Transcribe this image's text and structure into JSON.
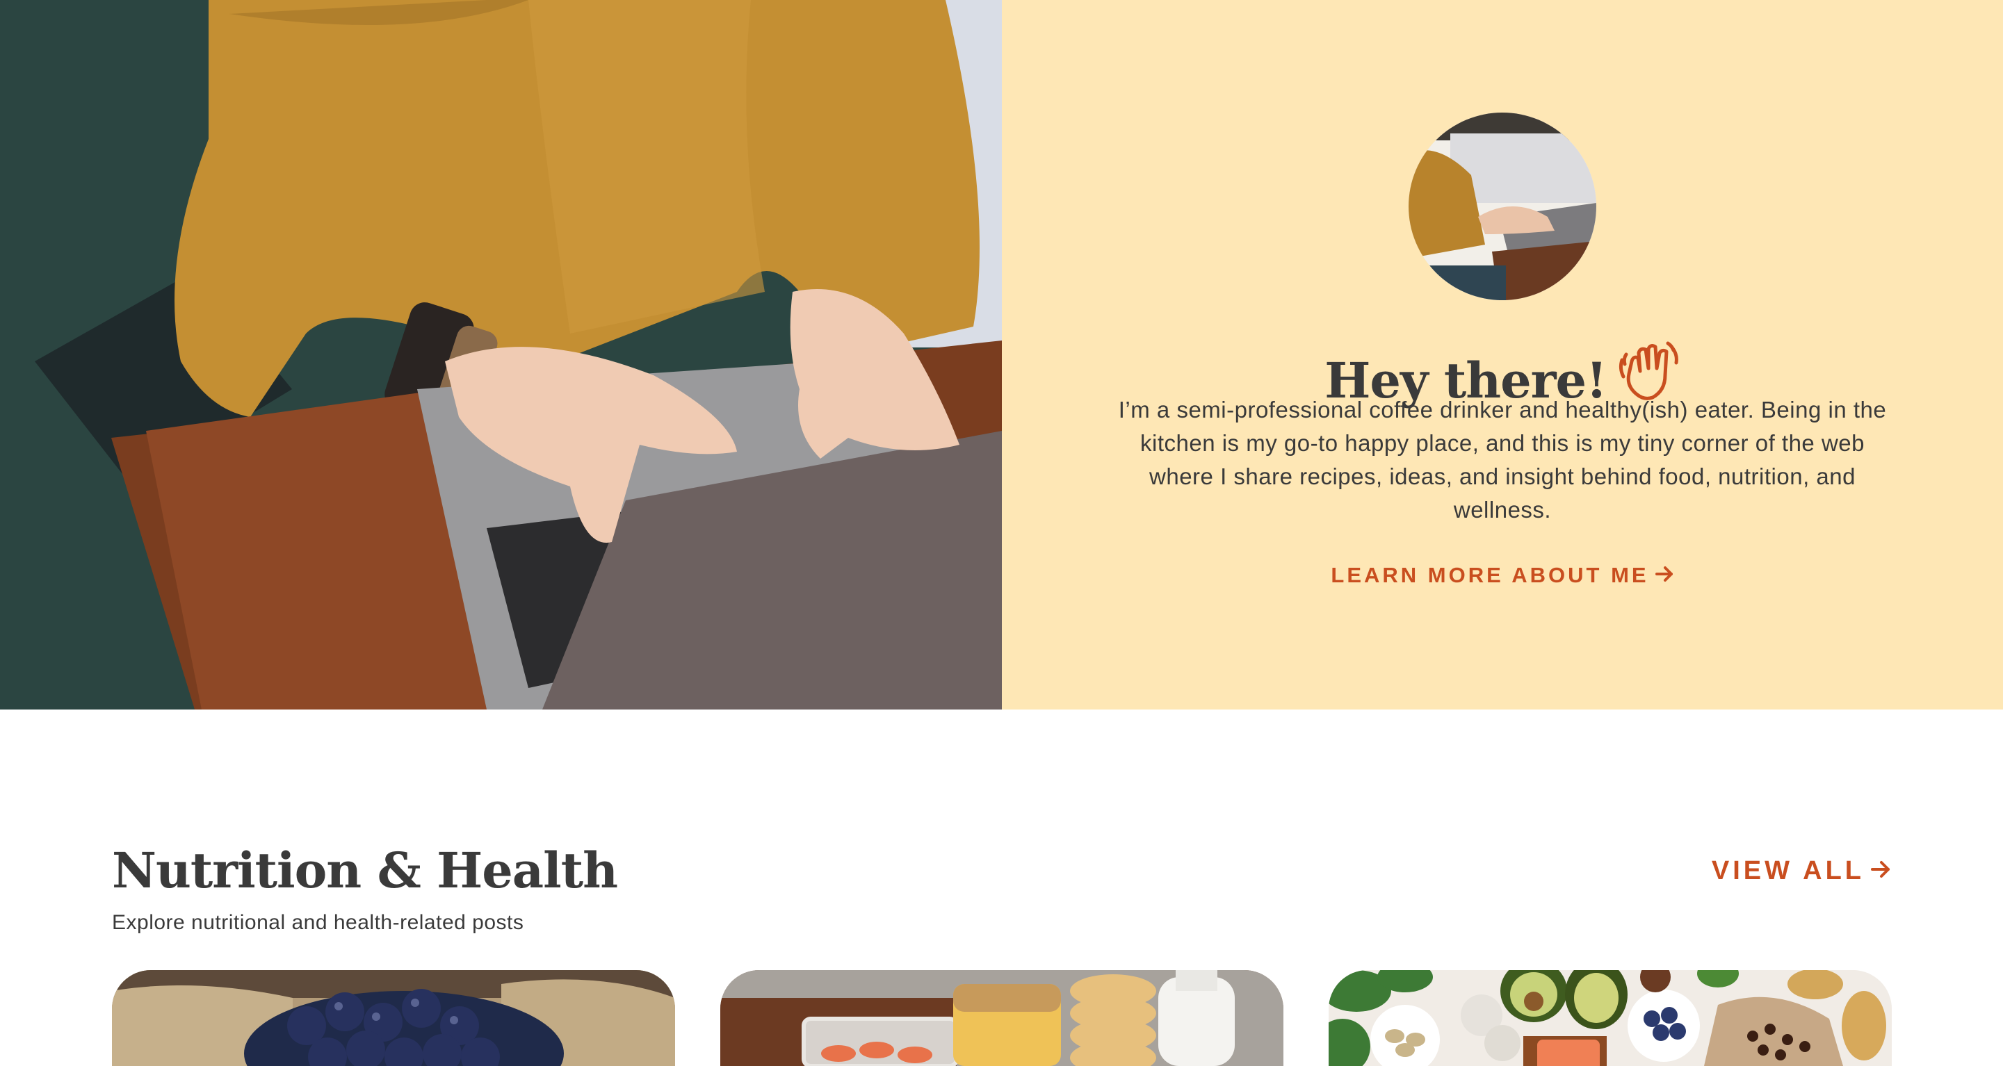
{
  "hero": {
    "title": "Hey there!",
    "wave_icon": "waving-hand-icon",
    "bio": "I’m a semi-professional coffee drinker and healthy(ish) eater. Being in the kitchen is my go-to happy place, and this is my tiny corner of the web where I share recipes, ideas, and insight behind food, nutrition, and wellness.",
    "link_label": "LEARN MORE ABOUT ME",
    "link_icon": "arrow-right-icon",
    "panel_color": "#fee7b5",
    "accent_color": "#c94e1f"
  },
  "section": {
    "title": "Nutrition & Health",
    "subtitle": "Explore nutritional and health-related posts",
    "view_all_label": "VIEW ALL",
    "cards": [
      {
        "image": "blueberries-photo"
      },
      {
        "image": "pantry-jars-photo"
      },
      {
        "image": "healthy-foods-photo"
      }
    ]
  }
}
